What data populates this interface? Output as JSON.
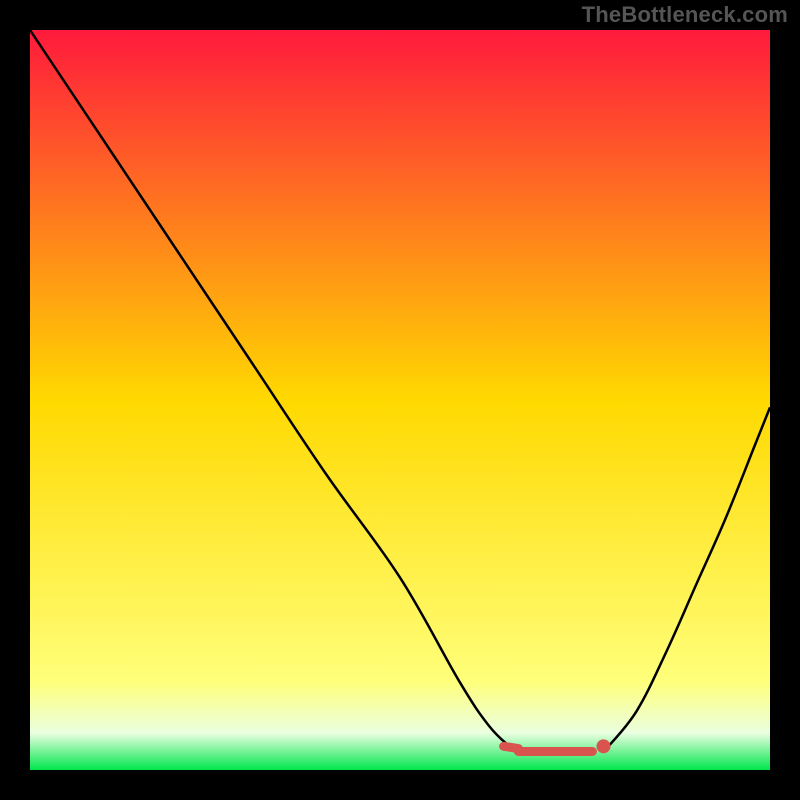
{
  "watermark": "TheBottleneck.com",
  "chart_data": {
    "type": "line",
    "title": "",
    "xlabel": "",
    "ylabel": "",
    "xlim": [
      0,
      100
    ],
    "ylim": [
      0,
      100
    ],
    "grid": false,
    "legend": false,
    "background_gradient": {
      "top_color": "#ff1a3c",
      "mid_color": "#ffd900",
      "band_upper_color": "#ffff7a",
      "band_lower_color": "#eaffe0",
      "bottom_color": "#00e64d"
    },
    "series": [
      {
        "name": "left-curve",
        "type": "line",
        "color": "#000000",
        "x": [
          0,
          10,
          20,
          30,
          40,
          50,
          58,
          62,
          65
        ],
        "values": [
          100,
          85,
          70,
          55,
          40,
          26,
          12,
          6,
          3
        ]
      },
      {
        "name": "right-curve",
        "type": "line",
        "color": "#000000",
        "x": [
          78,
          82,
          86,
          90,
          94,
          98,
          100
        ],
        "values": [
          3,
          8,
          16,
          25,
          34,
          44,
          49
        ]
      },
      {
        "name": "flat-bottom-left-stub",
        "type": "line",
        "color": "#d9534f",
        "x": [
          64,
          66
        ],
        "values": [
          3.2,
          2.9
        ]
      },
      {
        "name": "flat-bottom-main",
        "type": "line",
        "color": "#d9534f",
        "x": [
          66,
          76
        ],
        "values": [
          2.5,
          2.5
        ]
      },
      {
        "name": "right-endpoint-marker",
        "type": "scatter",
        "color": "#d9534f",
        "x": [
          77.5
        ],
        "values": [
          3.2
        ]
      }
    ]
  }
}
